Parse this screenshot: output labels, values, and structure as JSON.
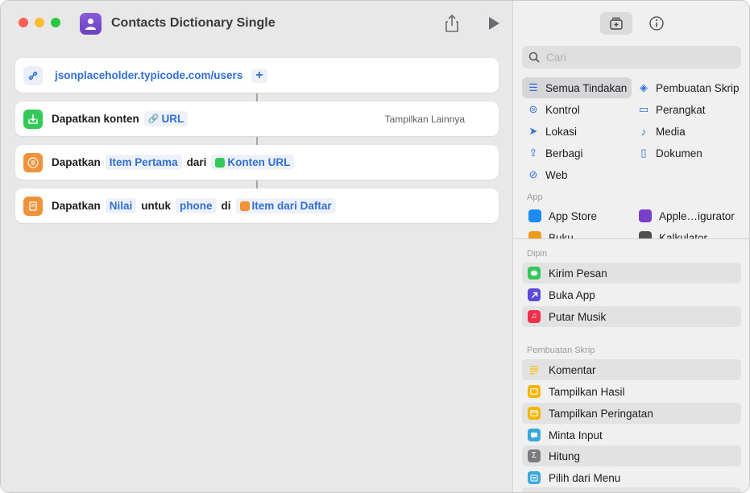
{
  "window": {
    "title": "Contacts Dictionary Single"
  },
  "editor": {
    "actions": [
      {
        "url": "jsonplaceholder.typicode.com/users",
        "add_label": "+"
      },
      {
        "verb": "Dapatkan konten",
        "param": "URL",
        "more": "Tampilkan Lainnya"
      },
      {
        "verb": "Dapatkan",
        "param": "Item Pertama",
        "conj": "dari",
        "var": "Konten URL"
      },
      {
        "verb": "Dapatkan",
        "param": "Nilai",
        "conj1": "untuk",
        "key": "phone",
        "conj2": "di",
        "var": "Item dari Daftar"
      }
    ]
  },
  "sidebar": {
    "search_placeholder": "Cari",
    "categories": [
      {
        "label": "Semua Tindakan",
        "icon": "list-icon",
        "selected": true
      },
      {
        "label": "Pembuatan Skrip",
        "icon": "script-icon"
      },
      {
        "label": "Kontrol",
        "icon": "toggle-icon"
      },
      {
        "label": "Perangkat",
        "icon": "display-icon"
      },
      {
        "label": "Lokasi",
        "icon": "location-arrow-icon"
      },
      {
        "label": "Media",
        "icon": "music-note-icon"
      },
      {
        "label": "Berbagi",
        "icon": "share-icon"
      },
      {
        "label": "Dokumen",
        "icon": "document-icon"
      },
      {
        "label": "Web",
        "icon": "compass-icon"
      }
    ],
    "app_section": "App",
    "apps": [
      {
        "label": "App Store",
        "color": "#1c8cf2"
      },
      {
        "label": "Apple…igurator",
        "color": "#7a3fc8"
      },
      {
        "label": "Buku",
        "color": "#f09a1c"
      },
      {
        "label": "Kalkulator",
        "color": "#505050"
      }
    ],
    "pinned_section": "Dipin",
    "pinned": [
      {
        "label": "Kirim Pesan",
        "color": "#34c759"
      },
      {
        "label": "Buka App",
        "color": "#5b4bd6"
      },
      {
        "label": "Putar Musik",
        "color": "#f0304a"
      }
    ],
    "scripting_section": "Pembuatan Skrip",
    "scripting": [
      {
        "label": "Komentar",
        "color": "#f5c518"
      },
      {
        "label": "Tampilkan Hasil",
        "color": "#f5b400"
      },
      {
        "label": "Tampilkan Peringatan",
        "color": "#f5b400"
      },
      {
        "label": "Minta Input",
        "color": "#39a9dc"
      },
      {
        "label": "Hitung",
        "color": "#7b7b7f"
      },
      {
        "label": "Pilih dari Menu",
        "color": "#39a9dc"
      }
    ]
  },
  "colors": {
    "accent": "#2f6fd6",
    "green": "#34c759",
    "orange": "#f0923a",
    "purple": "#7a4fd0"
  }
}
